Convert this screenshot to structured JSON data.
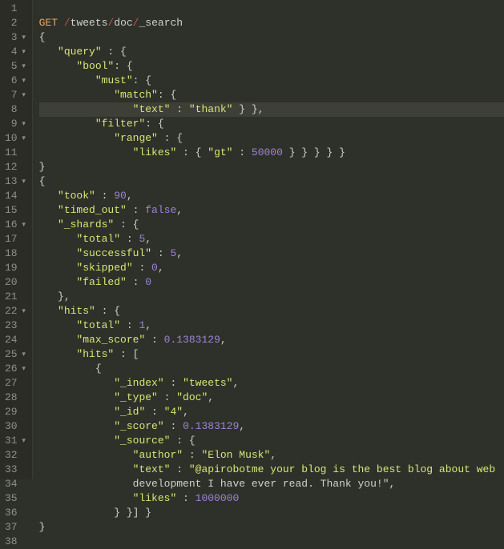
{
  "request": {
    "method": "GET",
    "path_parts": [
      "tweets",
      "doc",
      "_search"
    ],
    "body_lines": [
      {
        "indent": 0,
        "tokens": [
          {
            "t": "pun",
            "v": "{"
          }
        ]
      },
      {
        "indent": 1,
        "tokens": [
          {
            "t": "key",
            "v": "\"query\""
          },
          {
            "t": "pun",
            "v": " : {"
          }
        ]
      },
      {
        "indent": 2,
        "tokens": [
          {
            "t": "key",
            "v": "\"bool\""
          },
          {
            "t": "pun",
            "v": ": {"
          }
        ]
      },
      {
        "indent": 3,
        "tokens": [
          {
            "t": "key",
            "v": "\"must\""
          },
          {
            "t": "pun",
            "v": ": {"
          }
        ]
      },
      {
        "indent": 4,
        "tokens": [
          {
            "t": "key",
            "v": "\"match\""
          },
          {
            "t": "pun",
            "v": ": {"
          }
        ]
      },
      {
        "indent": 5,
        "tokens": [
          {
            "t": "key",
            "v": "\"text\""
          },
          {
            "t": "pun",
            "v": " : "
          },
          {
            "t": "str",
            "v": "\"thank\""
          },
          {
            "t": "pun",
            "v": " } },"
          }
        ],
        "hl": true
      },
      {
        "indent": 3,
        "tokens": [
          {
            "t": "key",
            "v": "\"filter\""
          },
          {
            "t": "pun",
            "v": ": {"
          }
        ]
      },
      {
        "indent": 4,
        "tokens": [
          {
            "t": "key",
            "v": "\"range\""
          },
          {
            "t": "pun",
            "v": " : {"
          }
        ]
      },
      {
        "indent": 5,
        "tokens": [
          {
            "t": "key",
            "v": "\"likes\""
          },
          {
            "t": "pun",
            "v": " : { "
          },
          {
            "t": "key",
            "v": "\"gt\""
          },
          {
            "t": "pun",
            "v": " : "
          },
          {
            "t": "num",
            "v": "50000"
          },
          {
            "t": "pun",
            "v": " } } } } }"
          }
        ]
      },
      {
        "indent": 0,
        "tokens": [
          {
            "t": "pun",
            "v": "}"
          }
        ]
      }
    ]
  },
  "response_lines": [
    {
      "indent": 0,
      "tokens": [
        {
          "t": "pun",
          "v": "{"
        }
      ]
    },
    {
      "indent": 1,
      "tokens": [
        {
          "t": "key",
          "v": "\"took\""
        },
        {
          "t": "pun",
          "v": " : "
        },
        {
          "t": "num",
          "v": "90"
        },
        {
          "t": "pun",
          "v": ","
        }
      ]
    },
    {
      "indent": 1,
      "tokens": [
        {
          "t": "key",
          "v": "\"timed_out\""
        },
        {
          "t": "pun",
          "v": " : "
        },
        {
          "t": "bool",
          "v": "false"
        },
        {
          "t": "pun",
          "v": ","
        }
      ]
    },
    {
      "indent": 1,
      "tokens": [
        {
          "t": "key",
          "v": "\"_shards\""
        },
        {
          "t": "pun",
          "v": " : {"
        }
      ]
    },
    {
      "indent": 2,
      "tokens": [
        {
          "t": "key",
          "v": "\"total\""
        },
        {
          "t": "pun",
          "v": " : "
        },
        {
          "t": "num",
          "v": "5"
        },
        {
          "t": "pun",
          "v": ","
        }
      ]
    },
    {
      "indent": 2,
      "tokens": [
        {
          "t": "key",
          "v": "\"successful\""
        },
        {
          "t": "pun",
          "v": " : "
        },
        {
          "t": "num",
          "v": "5"
        },
        {
          "t": "pun",
          "v": ","
        }
      ]
    },
    {
      "indent": 2,
      "tokens": [
        {
          "t": "key",
          "v": "\"skipped\""
        },
        {
          "t": "pun",
          "v": " : "
        },
        {
          "t": "num",
          "v": "0"
        },
        {
          "t": "pun",
          "v": ","
        }
      ]
    },
    {
      "indent": 2,
      "tokens": [
        {
          "t": "key",
          "v": "\"failed\""
        },
        {
          "t": "pun",
          "v": " : "
        },
        {
          "t": "num",
          "v": "0"
        }
      ]
    },
    {
      "indent": 1,
      "tokens": [
        {
          "t": "pun",
          "v": "},"
        }
      ]
    },
    {
      "indent": 1,
      "tokens": [
        {
          "t": "key",
          "v": "\"hits\""
        },
        {
          "t": "pun",
          "v": " : {"
        }
      ]
    },
    {
      "indent": 2,
      "tokens": [
        {
          "t": "key",
          "v": "\"total\""
        },
        {
          "t": "pun",
          "v": " : "
        },
        {
          "t": "num",
          "v": "1"
        },
        {
          "t": "pun",
          "v": ","
        }
      ]
    },
    {
      "indent": 2,
      "tokens": [
        {
          "t": "key",
          "v": "\"max_score\""
        },
        {
          "t": "pun",
          "v": " : "
        },
        {
          "t": "num",
          "v": "0.1383129"
        },
        {
          "t": "pun",
          "v": ","
        }
      ]
    },
    {
      "indent": 2,
      "tokens": [
        {
          "t": "key",
          "v": "\"hits\""
        },
        {
          "t": "pun",
          "v": " : ["
        }
      ]
    },
    {
      "indent": 3,
      "tokens": [
        {
          "t": "pun",
          "v": "{"
        }
      ]
    },
    {
      "indent": 4,
      "tokens": [
        {
          "t": "key",
          "v": "\"_index\""
        },
        {
          "t": "pun",
          "v": " : "
        },
        {
          "t": "str",
          "v": "\"tweets\""
        },
        {
          "t": "pun",
          "v": ","
        }
      ]
    },
    {
      "indent": 4,
      "tokens": [
        {
          "t": "key",
          "v": "\"_type\""
        },
        {
          "t": "pun",
          "v": " : "
        },
        {
          "t": "str",
          "v": "\"doc\""
        },
        {
          "t": "pun",
          "v": ","
        }
      ]
    },
    {
      "indent": 4,
      "tokens": [
        {
          "t": "key",
          "v": "\"_id\""
        },
        {
          "t": "pun",
          "v": " : "
        },
        {
          "t": "str",
          "v": "\"4\""
        },
        {
          "t": "pun",
          "v": ","
        }
      ]
    },
    {
      "indent": 4,
      "tokens": [
        {
          "t": "key",
          "v": "\"_score\""
        },
        {
          "t": "pun",
          "v": " : "
        },
        {
          "t": "num",
          "v": "0.1383129"
        },
        {
          "t": "pun",
          "v": ","
        }
      ]
    },
    {
      "indent": 4,
      "tokens": [
        {
          "t": "key",
          "v": "\"_source\""
        },
        {
          "t": "pun",
          "v": " : {"
        }
      ]
    },
    {
      "indent": 5,
      "tokens": [
        {
          "t": "key",
          "v": "\"author\""
        },
        {
          "t": "pun",
          "v": " : "
        },
        {
          "t": "str",
          "v": "\"Elon Musk\""
        },
        {
          "t": "pun",
          "v": ","
        }
      ]
    },
    {
      "indent": 5,
      "tokens": [
        {
          "t": "key",
          "v": "\"text\""
        },
        {
          "t": "pun",
          "v": " : "
        },
        {
          "t": "str",
          "v": "\"@apirobotme your blog is the best blog about web"
        }
      ]
    },
    {
      "indent": 5,
      "tokens": [
        {
          "t": "txt",
          "v": "development I have ever read. Thank you!\""
        },
        {
          "t": "pun",
          "v": ","
        }
      ]
    },
    {
      "indent": 5,
      "tokens": [
        {
          "t": "key",
          "v": "\"likes\""
        },
        {
          "t": "pun",
          "v": " : "
        },
        {
          "t": "num",
          "v": "1000000"
        }
      ]
    },
    {
      "indent": 4,
      "tokens": [
        {
          "t": "pun",
          "v": "} }] }"
        }
      ]
    },
    {
      "indent": 0,
      "tokens": [
        {
          "t": "pun",
          "v": "}"
        }
      ]
    }
  ],
  "fold_lines": [
    3,
    4,
    5,
    6,
    7,
    9,
    10,
    13,
    16,
    22,
    25,
    26,
    31
  ],
  "colors": {
    "bg": "#2e3129",
    "gutter_bg": "#2a2c25",
    "gutter_fg": "#8f908a",
    "key": "#d9e577",
    "num": "#a082d9",
    "kw": "#e6a96b",
    "slash": "#c7534e"
  }
}
